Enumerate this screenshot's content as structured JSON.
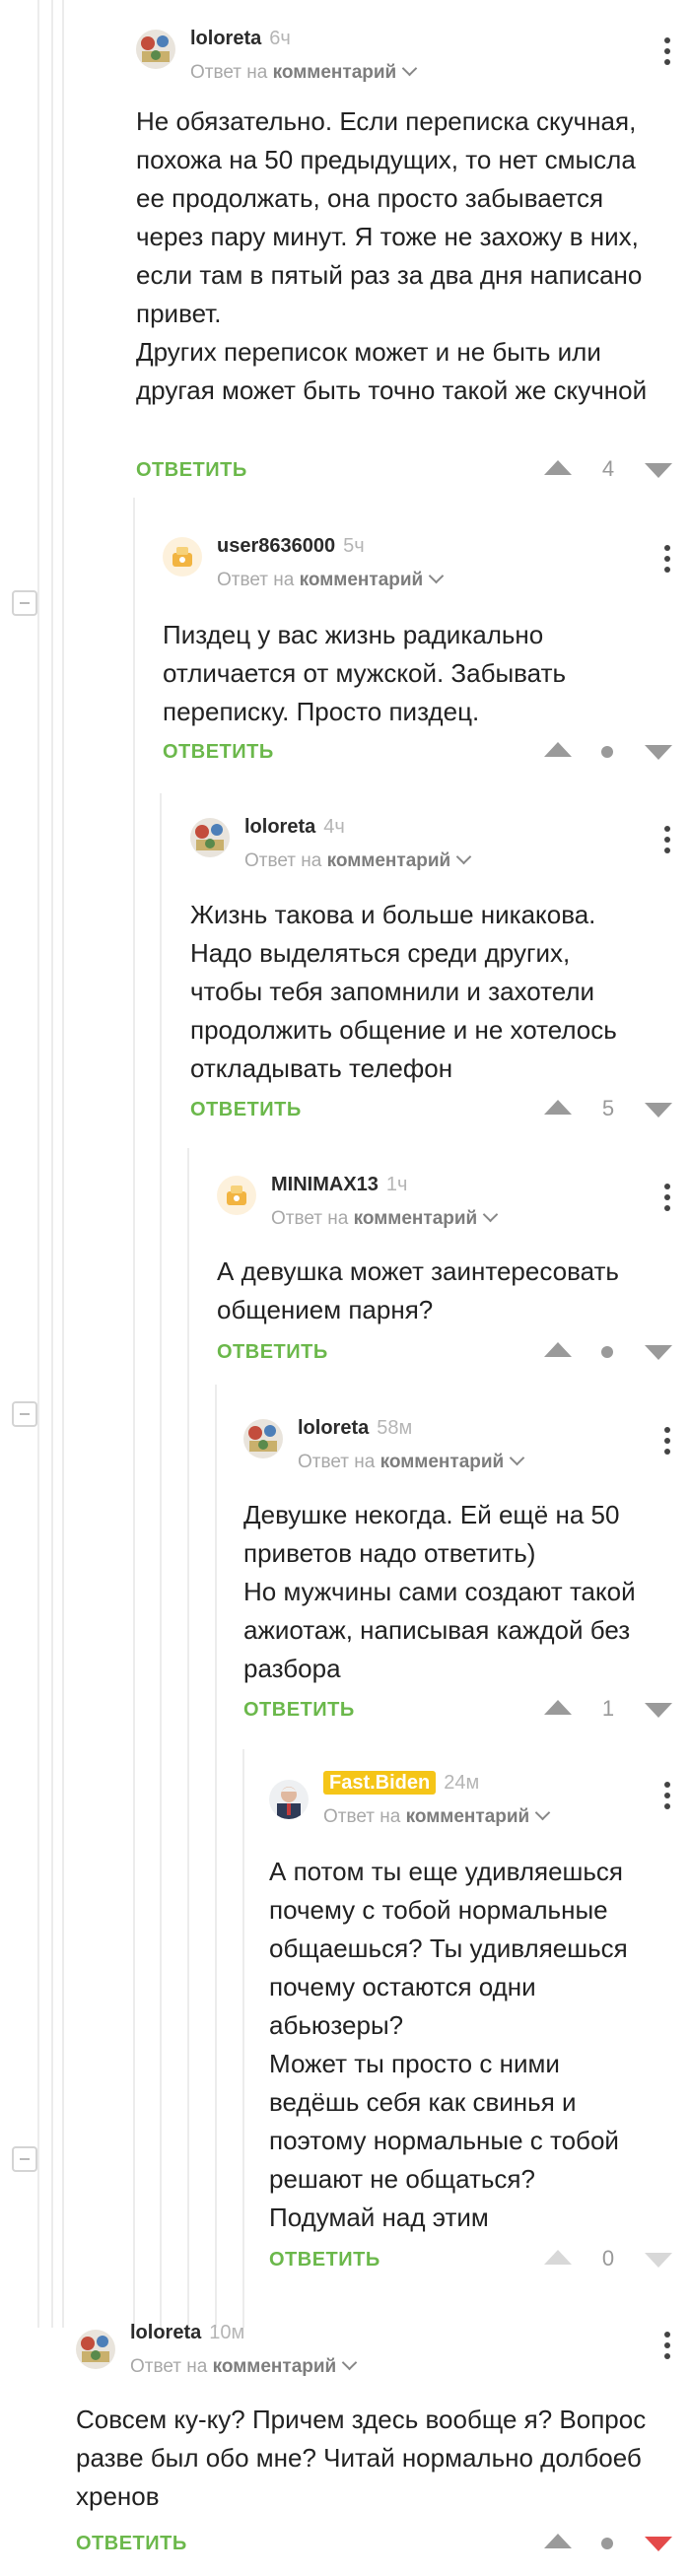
{
  "comments": [
    {
      "author": "loloreta",
      "time": "6ч",
      "reply_prefix": "Ответ на",
      "reply_target": "комментарий",
      "text": "Не обязательно. Если переписка скучная, похожа на 50 предыдущих, то нет смысла ее продолжать, она просто забывается через пару минут. Я тоже не захожу в них, если там в пятый раз за два дня написано привет.\nДругих переписок может и не быть или другая может быть точно такой же скучной",
      "reply_label": "ОТВЕТИТЬ",
      "score": "4"
    },
    {
      "author": "user8636000",
      "time": "5ч",
      "reply_prefix": "Ответ на",
      "reply_target": "комментарий",
      "text": "Пиздец у вас жизнь радикально отличается от мужской. Забывать переписку. Просто пиздец.",
      "reply_label": "ОТВЕТИТЬ",
      "score": ""
    },
    {
      "author": "loloreta",
      "time": "4ч",
      "reply_prefix": "Ответ на",
      "reply_target": "комментарий",
      "text": "Жизнь такова и больше никакова. Надо выделяться среди других, чтобы тебя запомнили и захотели продолжить общение и не хотелось откладывать телефон",
      "reply_label": "ОТВЕТИТЬ",
      "score": "5"
    },
    {
      "author": "MINIMAX13",
      "time": "1ч",
      "reply_prefix": "Ответ на",
      "reply_target": "комментарий",
      "text": "А девушка может заинтересовать общением парня?",
      "reply_label": "ОТВЕТИТЬ",
      "score": ""
    },
    {
      "author": "loloreta",
      "time": "58м",
      "reply_prefix": "Ответ на",
      "reply_target": "комментарий",
      "text": "Девушке некогда. Ей ещё на 50 приветов надо ответить)\nНо мужчины сами создают такой ажиотаж, написывая каждой без разбора",
      "reply_label": "ОТВЕТИТЬ",
      "score": "1"
    },
    {
      "author": "Fast.Biden",
      "time": "24м",
      "reply_prefix": "Ответ на",
      "reply_target": "комментарий",
      "text": "А потом ты еще удивляешься почему с тобой нормальные общаешься? Ты удивляешься почему остаются одни абьюзеры?\nМожет ты просто с ними ведёшь себя как свинья и поэтому нормальные с тобой решают не общаться?\nПодумай над этим",
      "reply_label": "ОТВЕТИТЬ",
      "score": "0"
    },
    {
      "author": "loloreta",
      "time": "10м",
      "reply_prefix": "Ответ на",
      "reply_target": "комментарий",
      "text": "Совсем ку-ку? Причем здесь вообще я? Вопрос разве был обо мне? Читай нормально долбоеб хренов",
      "reply_label": "ОТВЕТИТЬ",
      "score": ""
    }
  ],
  "colors": {
    "accent": "#6bb84b",
    "badge": "#f5c518",
    "downvote_active": "#e44a4a"
  }
}
